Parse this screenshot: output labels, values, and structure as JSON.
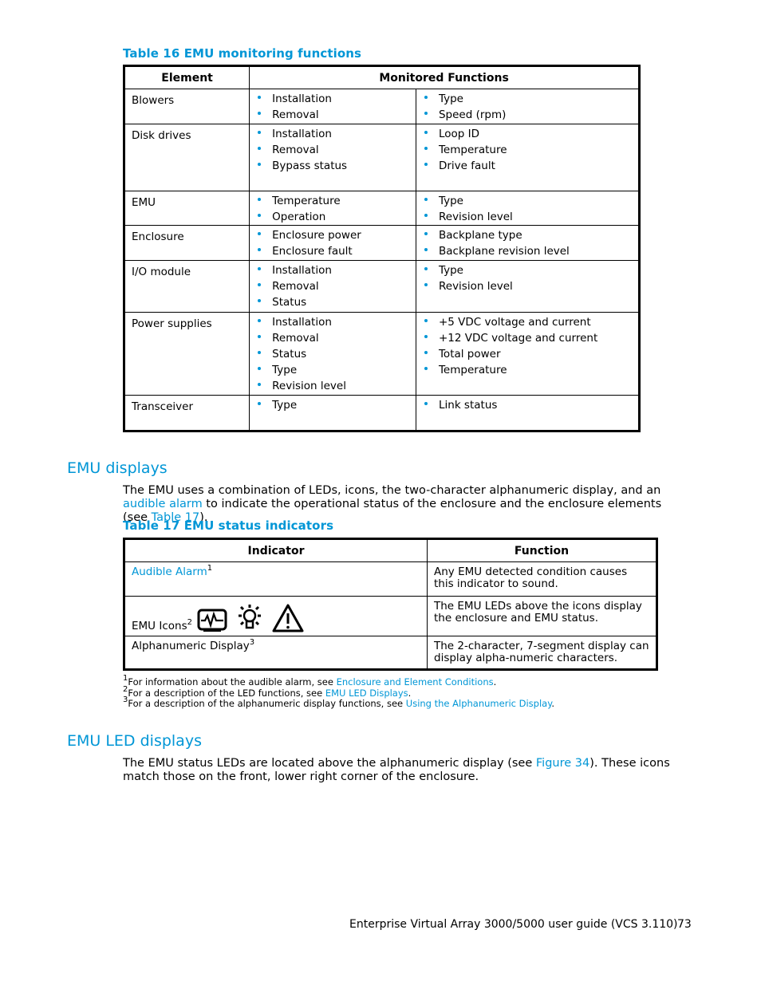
{
  "table16": {
    "caption": "Table 16 EMU monitoring functions",
    "headers": {
      "element": "Element",
      "functions": "Monitored Functions"
    },
    "rows": [
      {
        "element": "Blowers",
        "col1": [
          "Installation",
          "Removal"
        ],
        "col2": [
          "Type",
          "Speed (rpm)"
        ]
      },
      {
        "element": "Disk drives",
        "col1": [
          "Installation",
          "Removal",
          "Bypass status"
        ],
        "col2": [
          "Loop ID",
          "Temperature",
          "Drive fault"
        ]
      },
      {
        "element": "EMU",
        "col1": [
          "Temperature",
          "Operation"
        ],
        "col2": [
          "Type",
          "Revision level"
        ]
      },
      {
        "element": "Enclosure",
        "col1": [
          "Enclosure power",
          "Enclosure fault"
        ],
        "col2": [
          "Backplane type",
          "Backplane revision level"
        ]
      },
      {
        "element": "I/O module",
        "col1": [
          "Installation",
          "Removal",
          "Status"
        ],
        "col2": [
          "Type",
          "Revision level"
        ]
      },
      {
        "element": "Power supplies",
        "col1": [
          "Installation",
          "Removal",
          "Status",
          "Type",
          "Revision level"
        ],
        "col2": [
          "+5 VDC voltage and current",
          "+12 VDC voltage and current",
          "Total power",
          "Temperature"
        ]
      },
      {
        "element": "Transceiver",
        "col1": [
          "Type"
        ],
        "col2": [
          "Link status"
        ]
      }
    ]
  },
  "emu_displays": {
    "heading": "EMU displays",
    "para_1": "The EMU uses a combination of LEDs, icons, the two-character alphanumeric display, and an ",
    "para_link_1": "audible alarm",
    "para_2": " to indicate the operational status of the enclosure and the enclosure elements (see ",
    "para_link_2": "Table 17",
    "para_3": ")."
  },
  "table17": {
    "caption": "Table 17 EMU status indicators",
    "headers": {
      "indicator": "Indicator",
      "function": "Function"
    },
    "rows": [
      {
        "indicator": "Audible Alarm",
        "sup": "1",
        "function": "Any EMU detected condition causes this indicator to sound."
      },
      {
        "indicator": "EMU Icons",
        "sup": "2",
        "icons": [
          "monitor-waveform-icon",
          "light-bulb-icon",
          "warning-triangle-icon"
        ],
        "function": "The EMU LEDs above the icons display the enclosure and EMU status."
      },
      {
        "indicator": "Alphanumeric Display",
        "sup": "3",
        "function": "The 2-character, 7-segment display can display alpha-numeric characters."
      }
    ]
  },
  "footnotes": [
    {
      "num": "1",
      "text": "For information about the audible alarm, see ",
      "link": "Enclosure and Element Conditions"
    },
    {
      "num": "2",
      "text": "For a description of the LED functions, see ",
      "link": "EMU LED Displays"
    },
    {
      "num": "3",
      "text": "For a description of the alphanumeric display functions, see ",
      "link": "Using the Alphanumeric Display"
    }
  ],
  "emu_led_displays": {
    "heading": "EMU LED displays",
    "para_1": "The EMU status LEDs are located above the alphanumeric display (see ",
    "para_link": "Figure 34",
    "para_2": ").  These icons match those on the front, lower right corner of the enclosure."
  },
  "footer": {
    "title": "Enterprise Virtual Array 3000/5000 user guide (VCS 3.110)",
    "page": "73"
  },
  "colors": {
    "accent": "#0096d6",
    "text": "#000000"
  }
}
